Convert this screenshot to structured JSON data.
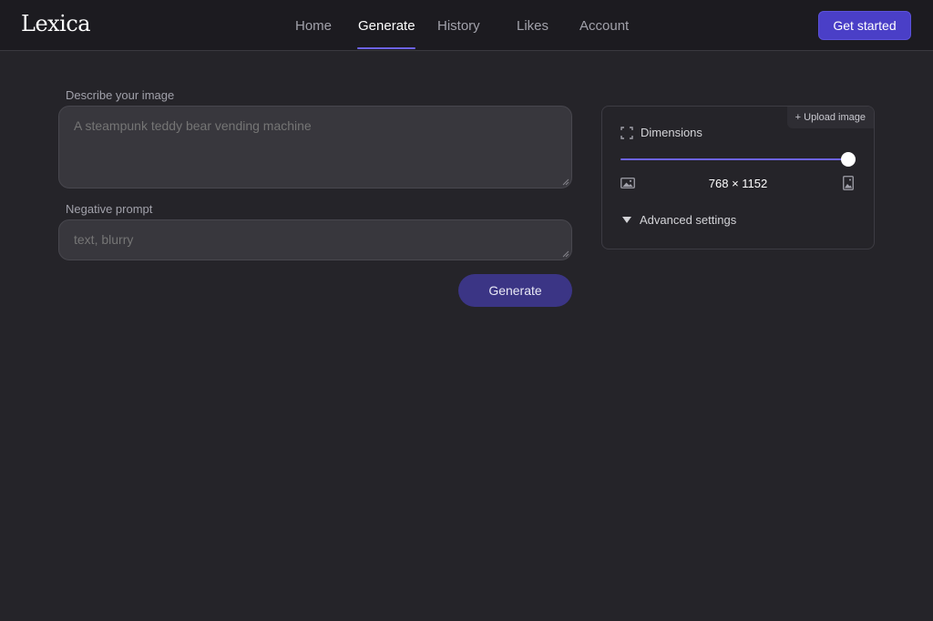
{
  "brand": {
    "logo_text": "Lexica"
  },
  "nav": {
    "items": [
      {
        "label": "Home",
        "active": false
      },
      {
        "label": "Generate",
        "active": true
      },
      {
        "label": "History",
        "active": false
      },
      {
        "label": "Likes",
        "active": false
      },
      {
        "label": "Account",
        "active": false
      }
    ],
    "cta_label": "Get started"
  },
  "form": {
    "prompt_label": "Describe your image",
    "prompt_placeholder": "A steampunk teddy bear vending machine",
    "prompt_value": "",
    "negative_label": "Negative prompt",
    "negative_placeholder": "text, blurry",
    "negative_value": "",
    "generate_label": "Generate"
  },
  "settings": {
    "upload_label": "+ Upload image",
    "dimensions_label": "Dimensions",
    "dimensions_value": "768 × 1152",
    "slider_level": 1.0,
    "advanced_label": "Advanced settings",
    "icons": [
      "expand-icon",
      "landscape-icon",
      "portrait-icon",
      "caret-down-icon"
    ]
  },
  "colors": {
    "background": "#252429",
    "topbar": "#1c1b20",
    "accent": "#6d63e8",
    "cta": "#4a3fc7",
    "generate_button": "#3b3585"
  }
}
